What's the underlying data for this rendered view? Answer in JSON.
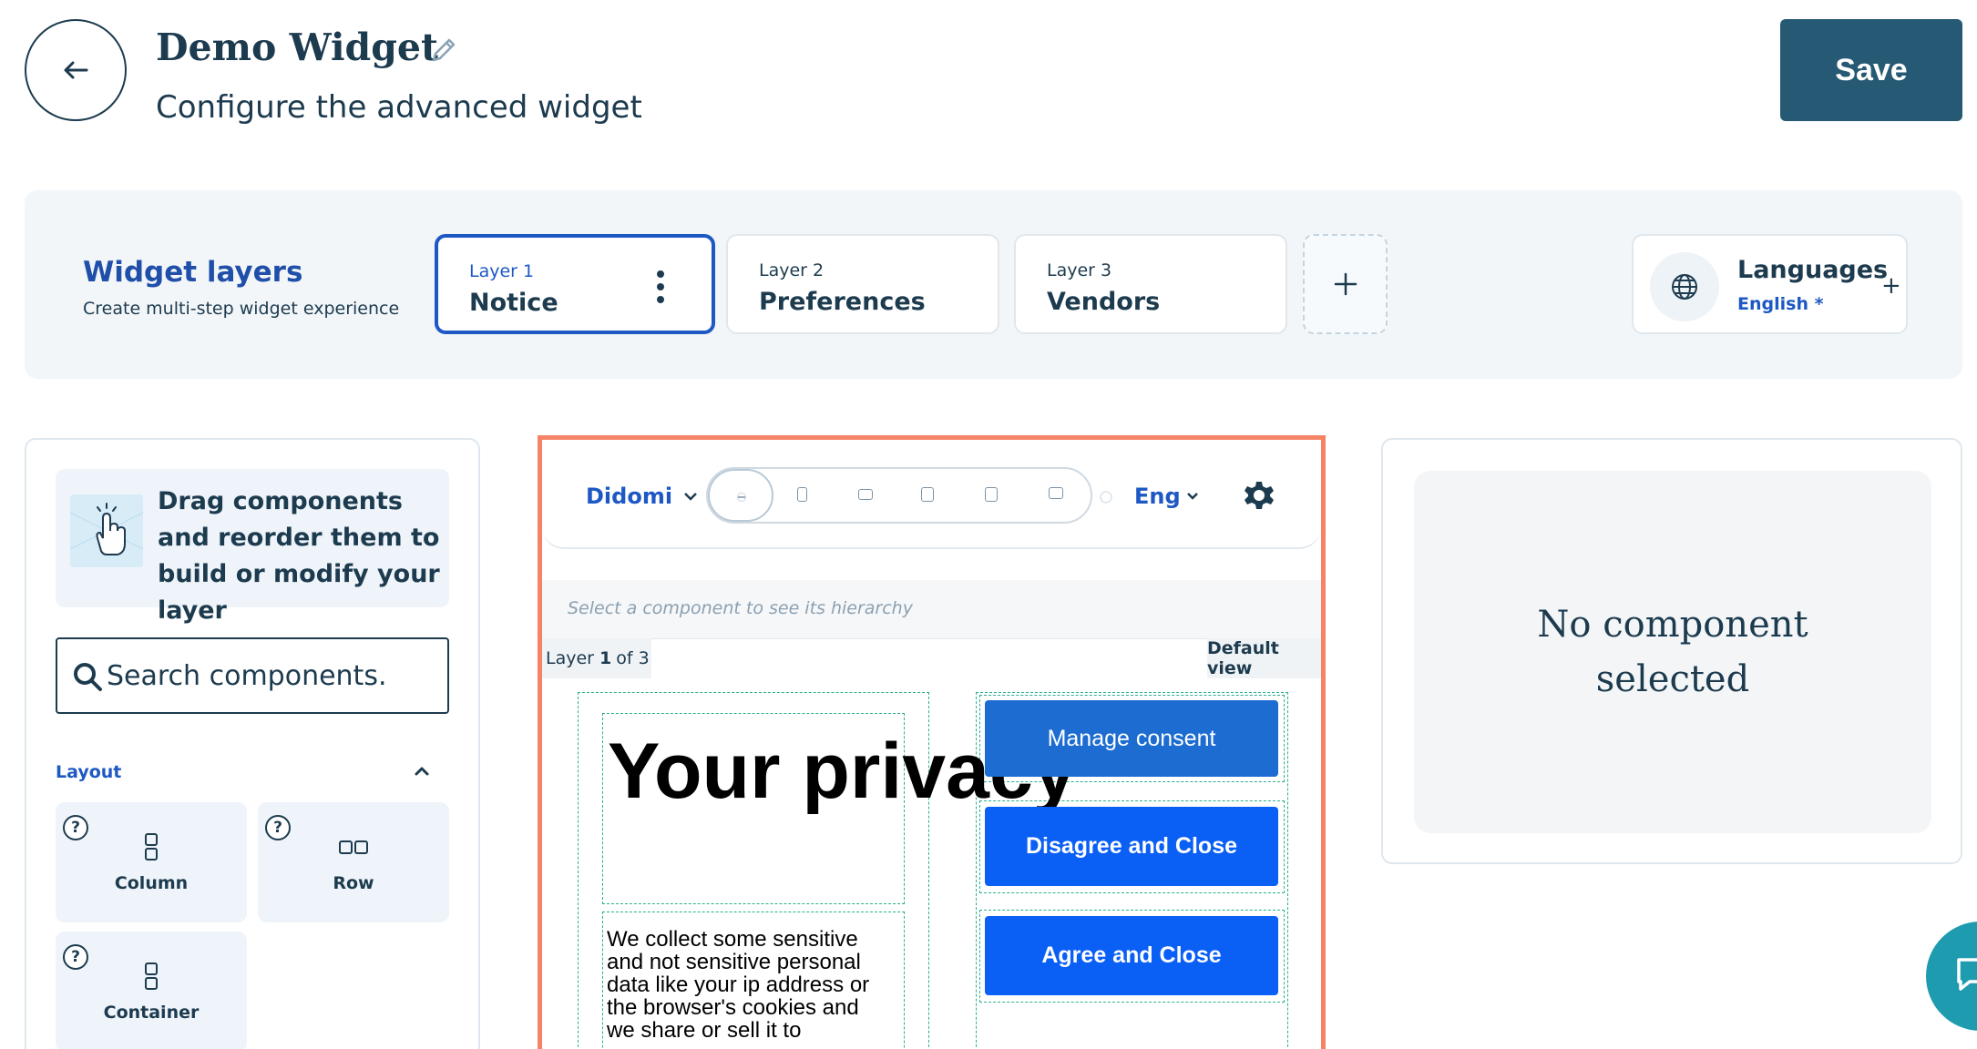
{
  "header": {
    "title": "Demo Widget",
    "subtitle": "Configure the advanced widget",
    "save_label": "Save"
  },
  "layers": {
    "title": "Widget layers",
    "subtitle": "Create multi-step widget experience",
    "items": [
      {
        "num": "Layer 1",
        "name": "Notice",
        "active": true
      },
      {
        "num": "Layer 2",
        "name": "Preferences"
      },
      {
        "num": "Layer 3",
        "name": "Vendors"
      }
    ],
    "add_label": "+",
    "languages": {
      "label": "Languages",
      "value": "English  *",
      "add": "+"
    }
  },
  "components_panel": {
    "hint": "Drag components and reorder them to build or modify your layer",
    "search": {
      "value": "",
      "placeholder": "Search components."
    },
    "section": "Layout",
    "items": [
      {
        "label": "Column",
        "help": "?"
      },
      {
        "label": "Row",
        "help": "?"
      },
      {
        "label": "Container",
        "help": "?"
      }
    ]
  },
  "preview": {
    "theme": "Didomi",
    "language": "Eng",
    "hierarchy_placeholder": "Select a component to see its hierarchy",
    "layer_counter": {
      "prefix": "Layer",
      "current": "1",
      "suffix": "of 3"
    },
    "view_label": "Default view",
    "notice": {
      "title": "Your privacy",
      "body": "We collect some sensitive and not sensitive personal data like your ip address or the browser's cookies and we share or sell it to",
      "buttons": {
        "manage": "Manage consent",
        "disagree": "Disagree and Close",
        "agree": "Agree and Close"
      }
    }
  },
  "inspector": {
    "empty_text": "No component selected"
  },
  "colors": {
    "brand_dark": "#265973",
    "accent_blue": "#1e58c4",
    "preview_border": "#f58466",
    "button_blue": "#0a5ff5",
    "chat": "#1f9bb0"
  }
}
